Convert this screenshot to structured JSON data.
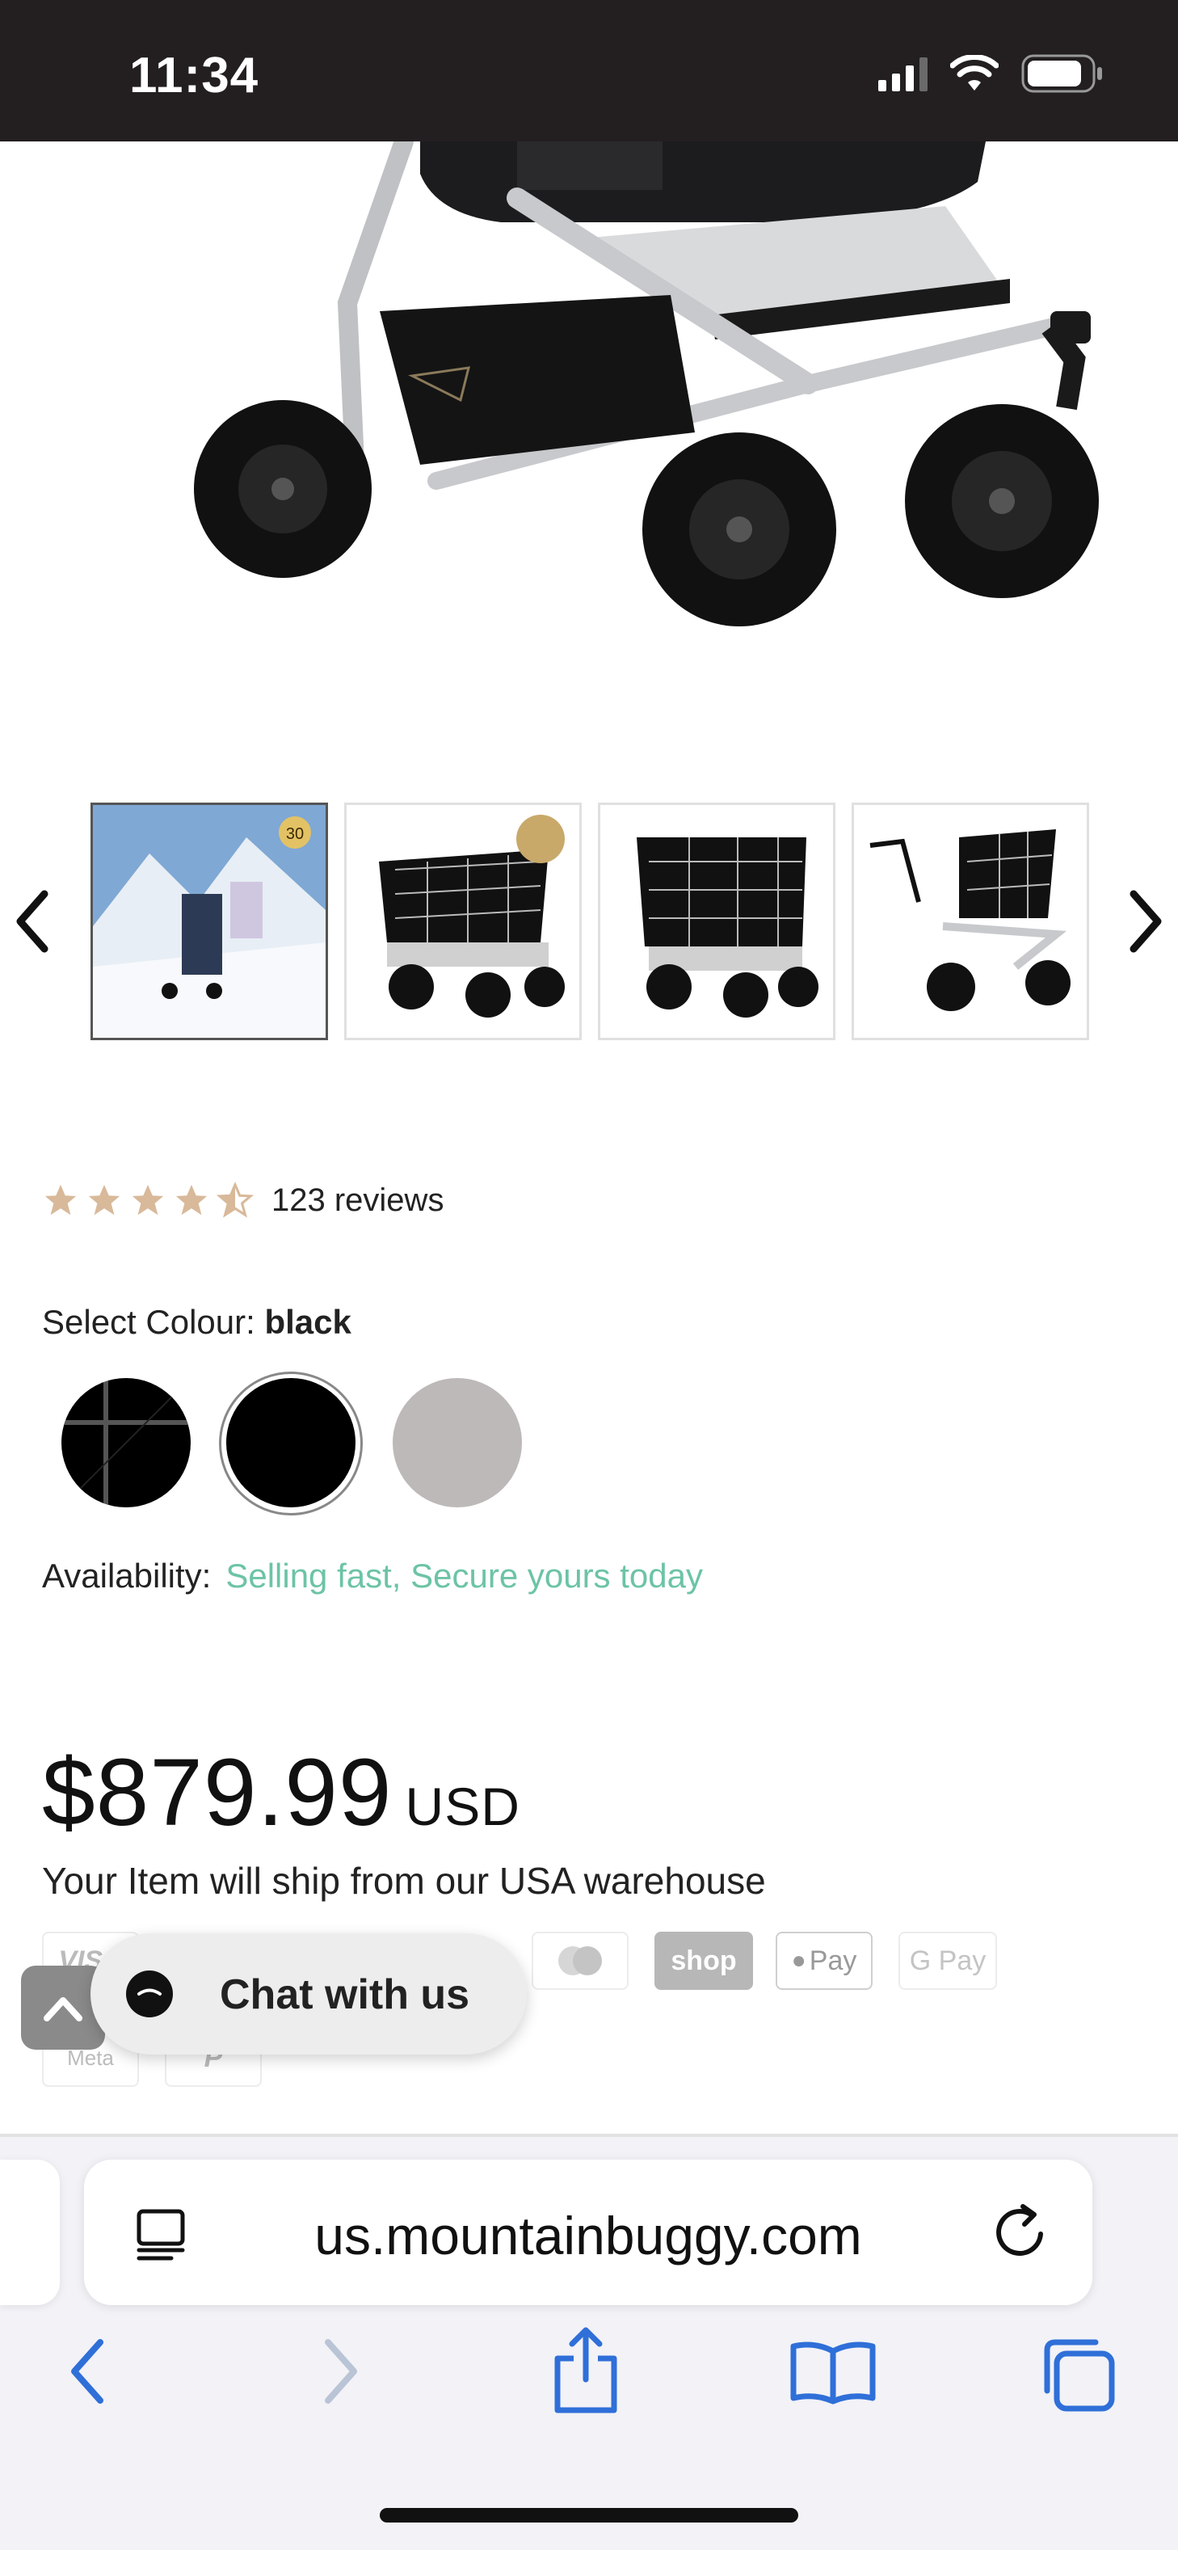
{
  "status_bar": {
    "time": "11:34"
  },
  "gallery": {
    "thumbnails": [
      {
        "name": "thumb-snow-lifestyle",
        "badge": "30"
      },
      {
        "name": "thumb-grid-pattern-front"
      },
      {
        "name": "thumb-grid-pattern-angle"
      },
      {
        "name": "thumb-single-grid-side"
      }
    ]
  },
  "product": {
    "rating": 4.5,
    "reviews_text": "123 reviews",
    "colour_label": "Select Colour: ",
    "colour_value": "black",
    "availability_label": "Availability:",
    "availability_value": "Selling fast, Secure yours today",
    "price": "$879.99",
    "currency": "USD",
    "ship_note": "Your Item will ship from our USA warehouse",
    "swatches": [
      {
        "name": "grid",
        "color": "#000000"
      },
      {
        "name": "black",
        "color": "#000000",
        "selected": true
      },
      {
        "name": "silver",
        "color": "#bdb9b8"
      }
    ]
  },
  "payments": [
    "VISA",
    "shop",
    "Pay",
    "G Pay",
    "Meta",
    "P"
  ],
  "chat": {
    "label": "Chat with us"
  },
  "browser": {
    "url": "us.mountainbuggy.com"
  },
  "colors": {
    "accent_green": "#6cc4a4",
    "star": "#d8b99a",
    "status_bar": "#231f20",
    "ios_blue": "#2f6fd8"
  }
}
